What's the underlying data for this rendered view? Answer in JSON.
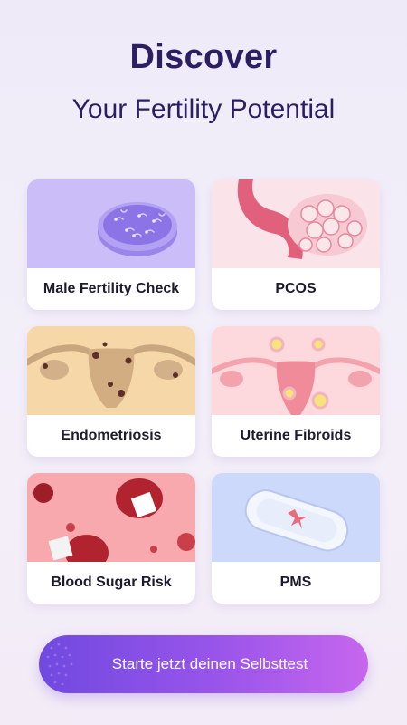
{
  "header": {
    "title": "Discover",
    "subtitle": "Your Fertility Potential"
  },
  "cards": [
    {
      "label": "Male Fertility Check",
      "image_icon": "petri-dish-icon",
      "bg": "#cbbdf7"
    },
    {
      "label": "PCOS",
      "image_icon": "ovary-icon",
      "bg": "#fbe3ea"
    },
    {
      "label": "Endometriosis",
      "image_icon": "uterus-icon",
      "bg": "#f5d7a8"
    },
    {
      "label": "Uterine Fibroids",
      "image_icon": "uterus-fibroids-icon",
      "bg": "#fdd8dc"
    },
    {
      "label": "Blood Sugar Risk",
      "image_icon": "blood-cells-sugar-icon",
      "bg": "#f7a9ad"
    },
    {
      "label": "PMS",
      "image_icon": "sanitary-pad-icon",
      "bg": "#ccd9fb"
    }
  ],
  "cta": {
    "label": "Starte jetzt deinen Selbsttest"
  },
  "colors": {
    "title": "#2b1f63",
    "cta_start": "#7049e0",
    "cta_end": "#c766ee"
  }
}
